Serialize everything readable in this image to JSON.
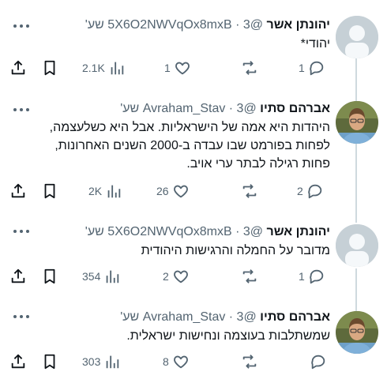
{
  "tweets": [
    {
      "author": "יהונתן אשר",
      "meta": "@5X6O2NWVqOx8mxB · 3 שע'",
      "text": [
        "יהודי*"
      ],
      "avatar": "default-avatar",
      "replies": "1",
      "retweets": "",
      "likes": "1",
      "views": "2.1K"
    },
    {
      "author": "אברהם סתיו",
      "meta": "@Avraham_Stav · 3 שע'",
      "text": [
        "היהדות היא אמה של הישראליות. אבל היא כשלעצמה,",
        "לפחות בפורמט שבו עבדה ב-2000 השנים האחרונות,",
        "פחות רגילה לבתר ערי אויב."
      ],
      "avatar": "photo-avatar",
      "replies": "2",
      "retweets": "",
      "likes": "26",
      "views": "2K"
    },
    {
      "author": "יהונתן אשר",
      "meta": "@5X6O2NWVqOx8mxB · 3 שע'",
      "text": [
        "מדובר על החמלה והרגישות היהודית"
      ],
      "avatar": "default-avatar",
      "replies": "1",
      "retweets": "",
      "likes": "2",
      "views": "354"
    },
    {
      "author": "אברהם סתיו",
      "meta": "@Avraham_Stav · 3 שע'",
      "text": [
        "שמשתלבות בעוצמה ונחישות ישראלית."
      ],
      "avatar": "photo-avatar",
      "replies": "",
      "retweets": "",
      "likes": "8",
      "views": "303"
    }
  ],
  "colors": {
    "text": "#0f1419",
    "secondary": "#536471",
    "thread_line": "#cfd9de",
    "default_avatar_bg": "#ccd6dd"
  }
}
